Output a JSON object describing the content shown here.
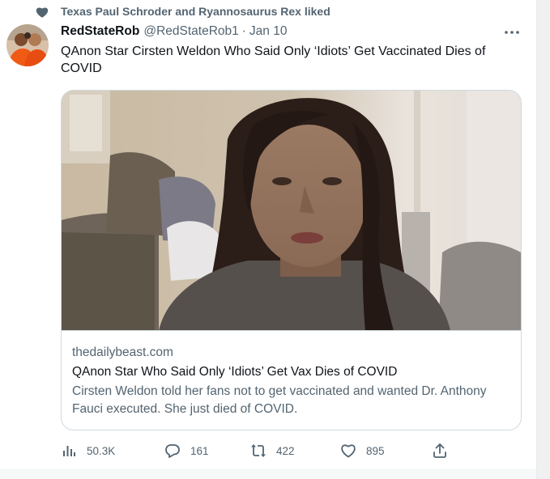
{
  "social_context": {
    "text": "Texas Paul Schroder and Ryannosaurus Rex liked",
    "icon": "heart-filled-icon",
    "color": "#536471"
  },
  "tweet": {
    "display_name": "RedStateRob",
    "handle": "@RedStateRob1",
    "separator": "·",
    "date": "Jan 10",
    "text": "QAnon Star Cirsten Weldon Who Said Only ‘Idiots’ Get Vaccinated Dies of COVID"
  },
  "card": {
    "domain": "thedailybeast.com",
    "title": "QAnon Star Who Said Only ‘Idiots’ Get Vax Dies of COVID",
    "description": "Cirsten Weldon told her fans not to get vaccinated and wanted Dr. Anthony Fauci executed. She just died of COVID."
  },
  "actions": {
    "views": {
      "icon": "analytics-icon",
      "count": "50.3K"
    },
    "reply": {
      "icon": "reply-icon",
      "count": "161"
    },
    "retweet": {
      "icon": "retweet-icon",
      "count": "422"
    },
    "like": {
      "icon": "heart-icon",
      "count": "895"
    },
    "share": {
      "icon": "share-icon"
    }
  },
  "colors": {
    "text_primary": "#0f1419",
    "text_secondary": "#536471",
    "border": "#cfd9de"
  }
}
